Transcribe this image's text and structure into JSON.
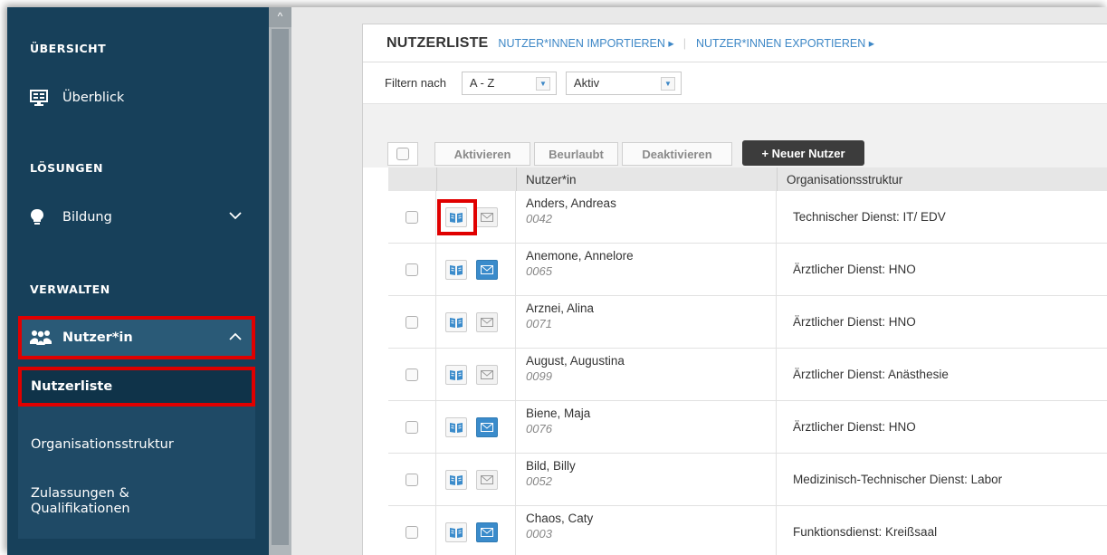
{
  "sidebar": {
    "section_overview": "ÜBERSICHT",
    "overview_item": "Überblick",
    "section_solutions": "LÖSUNGEN",
    "education_item": "Bildung",
    "section_manage": "VERWALTEN",
    "users_item": "Nutzer*in",
    "sub_items": [
      "Nutzerliste",
      "Organisationsstruktur",
      "Zulassungen &",
      "Qualifikationen"
    ],
    "icons": [
      "monitor-icon",
      "lightbulb-icon",
      "users-icon"
    ]
  },
  "header": {
    "title": "NUTZERLISTE",
    "import_link": "NUTZER*INNEN IMPORTIEREN ▸",
    "separator": "|",
    "export_link": "NUTZER*INNEN EXPORTIEREN ▸"
  },
  "filter": {
    "label": "Filtern nach",
    "sort_value": "A - Z",
    "status_value": "Aktiv"
  },
  "toolbar": {
    "activate": "Aktivieren",
    "on_leave": "Beurlaubt",
    "deactivate": "Deaktivieren",
    "new_user": "+ Neuer Nutzer"
  },
  "table": {
    "columns": [
      "",
      "",
      "Nutzer*in",
      "Organisationsstruktur"
    ],
    "rows": [
      {
        "name": "Anders, Andreas",
        "number": "0042",
        "org": "Technischer Dienst: IT/ EDV",
        "mail_active": false
      },
      {
        "name": "Anemone, Annelore",
        "number": "0065",
        "org": "Ärztlicher Dienst: HNO",
        "mail_active": true
      },
      {
        "name": "Arznei, Alina",
        "number": "0071",
        "org": "Ärztlicher Dienst: HNO",
        "mail_active": false
      },
      {
        "name": "August, Augustina",
        "number": "0099",
        "org": "Ärztlicher Dienst: Anästhesie",
        "mail_active": false
      },
      {
        "name": "Biene, Maja",
        "number": "0076",
        "org": "Ärztlicher Dienst: HNO",
        "mail_active": true
      },
      {
        "name": "Bild, Billy",
        "number": "0052",
        "org": "Medizinisch-Technischer Dienst: Labor",
        "mail_active": false
      },
      {
        "name": "Chaos, Caty",
        "number": "0003",
        "org": "Funktionsdienst: Kreißsaal",
        "mail_active": true
      }
    ]
  },
  "colors": {
    "sidebar_bg": "#17405a",
    "highlight": "#e00000",
    "link": "#3d87c6"
  }
}
